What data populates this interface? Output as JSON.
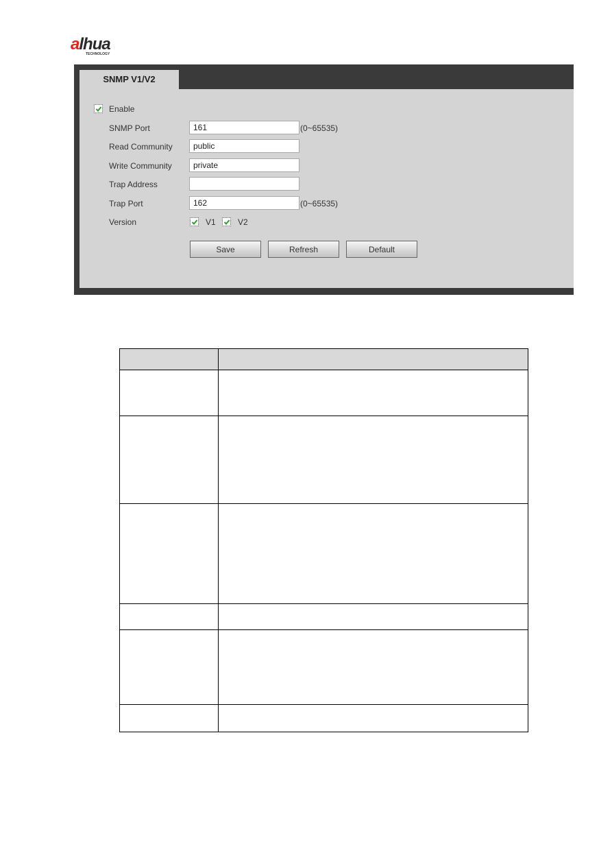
{
  "brand": {
    "logo_text_accent": "a",
    "logo_text_main": "lhua",
    "logo_subtitle": "TECHNOLOGY",
    "accent_color": "#e1251b"
  },
  "panel": {
    "tab_label": "SNMP V1/V2",
    "enable": {
      "label": "Enable",
      "checked": true
    },
    "fields": [
      {
        "label": "SNMP Port",
        "value": "161",
        "placeholder": "",
        "hint": "(0~65535)"
      },
      {
        "label": "Read Community",
        "value": "public",
        "placeholder": "",
        "hint": ""
      },
      {
        "label": "Write Community",
        "value": "private",
        "placeholder": "",
        "hint": ""
      },
      {
        "label": "Trap Address",
        "value": "",
        "placeholder": "",
        "hint": ""
      },
      {
        "label": "Trap Port",
        "value": "162",
        "placeholder": "",
        "hint": "(0~65535)"
      }
    ],
    "version": {
      "label": "Version",
      "options": [
        {
          "label": "V1",
          "checked": true
        },
        {
          "label": "V2",
          "checked": true
        }
      ]
    },
    "buttons": {
      "save": "Save",
      "refresh": "Refresh",
      "default": "Default"
    }
  },
  "table": {
    "headers": [
      "",
      ""
    ],
    "rows": [
      [
        "",
        ""
      ],
      [
        "",
        ""
      ],
      [
        "",
        ""
      ],
      [
        "",
        ""
      ],
      [
        "",
        ""
      ],
      [
        "",
        ""
      ]
    ]
  }
}
